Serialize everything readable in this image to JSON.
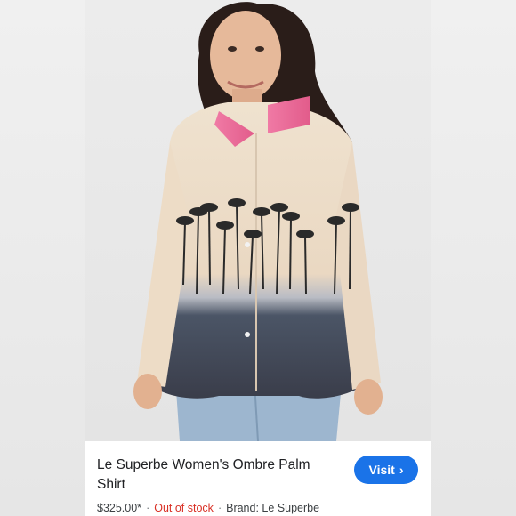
{
  "product": {
    "title": "Le Superbe Women's Ombre Palm Shirt",
    "price": "$325.00*",
    "separator": "·",
    "stock_status": "Out of stock",
    "brand": "Brand: Le Superbe",
    "visit_label": "Visit",
    "visit_icon": "chevron-right-icon"
  },
  "colors": {
    "accent": "#1a73e8",
    "out_of_stock": "#d93025",
    "collar_pink": "#e8709a",
    "ombre_dark": "#3a4456",
    "shirt_cream": "#ecdcc6"
  }
}
